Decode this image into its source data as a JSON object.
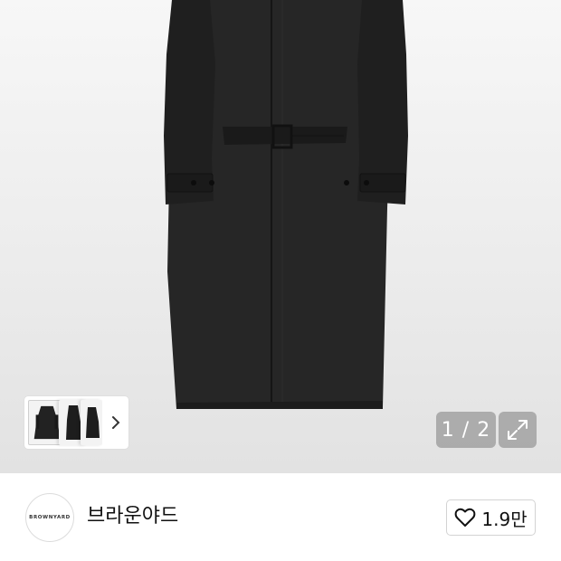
{
  "gallery": {
    "image": "long-black-belted-coat",
    "counter": "1 / 2",
    "thumbnails": [
      "coat-front",
      "coat-side",
      "coat-back"
    ],
    "icons": {
      "next": "chevron-right-icon",
      "expand": "expand-arrows-icon"
    }
  },
  "seller": {
    "logo_text": "BROWNYARD",
    "name": "브라운야드",
    "likes": "1.9만",
    "like_icon": "heart-outline-icon"
  }
}
